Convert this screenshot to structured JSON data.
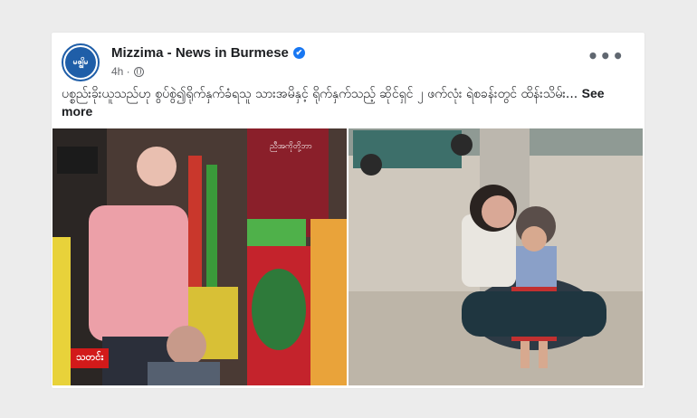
{
  "post": {
    "page_name": "Mizzima - News in Burmese",
    "avatar_text": "မဇ္ဈိမ",
    "verified_icon": "✔",
    "time": "4h ·",
    "more_label": "•••",
    "text": "ပစ္စည်းခိုးယူသည်ဟု စွပ်စွဲ၍ရိုက်နှက်ခံရသူ သားအမိနှင့် ရိုက်နှက်သည့် ဆိုင်ရှင် ၂ ဖက်လုံး ရဲစခန်းတွင် ထိန်းသိမ်း... ",
    "see_more": "See more"
  },
  "photos": {
    "left_badge": "သတင်း",
    "left_overlay": "ညီအကိုတို့ဘာ"
  },
  "colors": {
    "accent": "#1877f2",
    "brand": "#1f5ea8",
    "badge": "#d21a1a"
  },
  "icons": [
    "verified-icon",
    "globe-icon",
    "more-options-icon"
  ]
}
